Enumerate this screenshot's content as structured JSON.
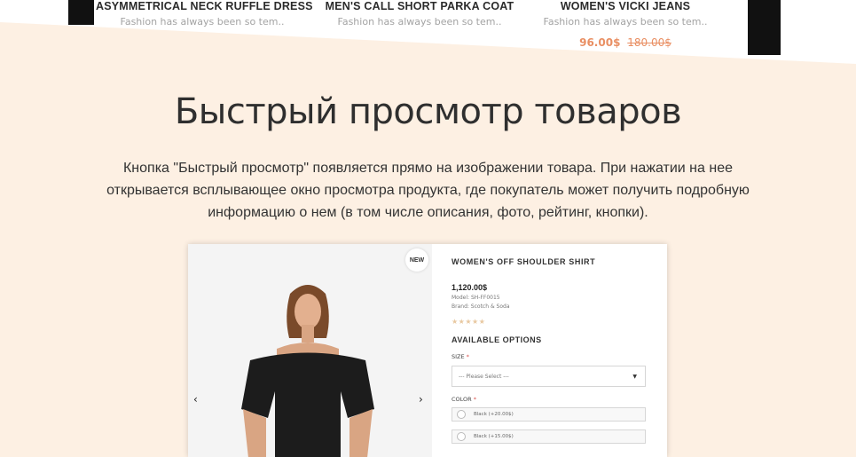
{
  "products": [
    {
      "name": "ASYMMETRICAL NECK RUFFLE DRESS",
      "desc": "Fashion has always been so tem..",
      "price": "",
      "old_price": ""
    },
    {
      "name": "MEN'S CALL SHORT PARKA COAT",
      "desc": "Fashion has always been so tem..",
      "price": "",
      "old_price": ""
    },
    {
      "name": "WOMEN'S VICKI JEANS",
      "desc": "Fashion has always been so tem..",
      "price": "96.00$",
      "old_price": "180.00$"
    }
  ],
  "section": {
    "title": "Быстрый просмотр товаров",
    "description": "Кнопка \"Быстрый просмотр\" появляется прямо на изображении товара. При нажатии на нее открывается всплывающее окно просмотра продукта, где покупатель может получить подробную информацию о нем (в том числе описания, фото, рейтинг, кнопки)."
  },
  "quickview": {
    "badge": "NEW",
    "prev_icon": "chevron-left-icon",
    "next_icon": "chevron-right-icon",
    "product_title": "WOMEN'S OFF SHOULDER SHIRT",
    "price": "1,120.00$",
    "model": "Model: SH-FF0015",
    "brand": "Brand: Scotch & Soda",
    "rating": 5,
    "stars": "★★★★★",
    "options_title": "AVAILABLE OPTIONS",
    "size_label": "SIZE",
    "size_placeholder": "--- Please Select ---",
    "color_label": "COLOR",
    "color_options": [
      "Black (+20.00$)",
      "Black (+15.00$)"
    ],
    "required_mark": "*"
  },
  "colors": {
    "background": "#fdf0e3",
    "accent_price": "#e98f63",
    "stars": "#e8c8a0"
  }
}
